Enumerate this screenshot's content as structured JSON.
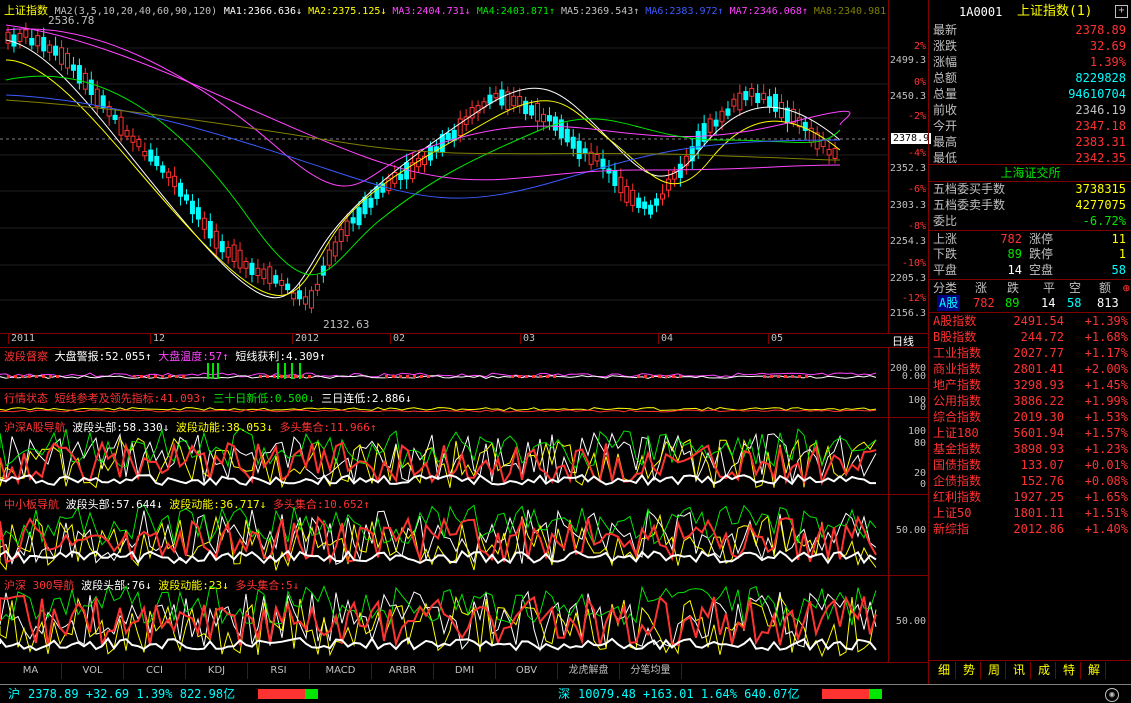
{
  "main": {
    "title": "上证指数",
    "ma_params": "MA2(3,5,10,20,40,60,90,120)",
    "ma_items": [
      {
        "label": "MA1:2366.636↓",
        "color": "#ffffff"
      },
      {
        "label": "MA2:2375.125↓",
        "color": "#ffff00"
      },
      {
        "label": "MA3:2404.731↓",
        "color": "#ff44ff"
      },
      {
        "label": "MA4:2403.871↑",
        "color": "#00e600"
      },
      {
        "label": "MA5:2369.543↑",
        "color": "#c0c0c0"
      },
      {
        "label": "MA6:2383.972↑",
        "color": "#3c5aff"
      },
      {
        "label": "MA7:2346.068↑",
        "color": "#ff44ff"
      },
      {
        "label": "MA8:2340.981",
        "color": "#808000"
      }
    ],
    "high_label": "2536.78",
    "low_label": "2132.63",
    "current_tag": "2378.9",
    "price_axis": [
      "2499.3",
      "2450.3",
      "2352.3",
      "2303.3",
      "2254.3",
      "2205.3",
      "2156.3"
    ],
    "pct_axis": [
      "2%",
      "0%",
      "-2%",
      "-4%",
      "-6%",
      "-8%",
      "-10%",
      "-12%"
    ],
    "date_labels": [
      "2011",
      "12",
      "2012",
      "02",
      "03",
      "04",
      "05"
    ],
    "period_label": "日线"
  },
  "panes": [
    {
      "head": [
        [
          "波段督察",
          "#ff3232"
        ],
        [
          "大盘警报:52.055↑",
          "#ffffff"
        ],
        [
          "大盘温度:57↑",
          "#ff44ff"
        ],
        [
          "短线获利:4.309↑",
          "#ffffff"
        ]
      ],
      "axis": [
        "200.00",
        "0.00"
      ]
    },
    {
      "head": [
        [
          "行情状态",
          "#ff3232"
        ],
        [
          "短线参考及领先指标:41.093↑",
          "#ff3232"
        ],
        [
          "三十日新低:0.500↓",
          "#00e600"
        ],
        [
          "三日连低:2.886↓",
          "#ffffff"
        ]
      ],
      "axis": [
        "100",
        "0"
      ]
    },
    {
      "head": [
        [
          "沪深A股导航",
          "#ff3232"
        ],
        [
          "波段头部:58.330↓",
          "#ffffff"
        ],
        [
          "波段动能:38.053↓",
          "#ffff00"
        ],
        [
          "多头集合:11.966↑",
          "#ff3232"
        ]
      ],
      "axis": [
        "100",
        "80",
        "20",
        "0"
      ]
    },
    {
      "head": [
        [
          "中小板导航",
          "#ff3232"
        ],
        [
          "波段头部:57.644↓",
          "#ffffff"
        ],
        [
          "波段动能:36.717↓",
          "#ffff00"
        ],
        [
          "多头集合:10.652↑",
          "#ff3232"
        ]
      ],
      "axis": [
        "50.00"
      ]
    },
    {
      "head": [
        [
          "沪深 300导航",
          "#ff3232"
        ],
        [
          "波段头部:76↓",
          "#ffffff"
        ],
        [
          "波段动能:23↓",
          "#ffff00"
        ],
        [
          "多头集合:5↓",
          "#ff3232"
        ]
      ],
      "axis": [
        "50.00"
      ]
    }
  ],
  "tabs": [
    "MA",
    "VOL",
    "CCI",
    "KDJ",
    "RSI",
    "MACD",
    "ARBR",
    "DMI",
    "OBV",
    "龙虎解盘",
    "分笔均量"
  ],
  "quote": {
    "code": "1A0001",
    "name": "上证指数(1)",
    "rows": [
      {
        "label": "最新",
        "value": "2378.89",
        "color": "#ff3232"
      },
      {
        "label": "涨跌",
        "value": "32.69",
        "color": "#ff3232"
      },
      {
        "label": "涨幅",
        "value": "1.39%",
        "color": "#ff3232"
      },
      {
        "label": "总额",
        "value": "8229828",
        "color": "#00ffff"
      },
      {
        "label": "总量",
        "value": "94610704",
        "color": "#00ffff"
      },
      {
        "label": "前收",
        "value": "2346.19",
        "color": "#c0c0c0"
      },
      {
        "label": "今开",
        "value": "2347.18",
        "color": "#ff3232"
      },
      {
        "label": "最高",
        "value": "2383.31",
        "color": "#ff3232"
      },
      {
        "label": "最低",
        "value": "2342.35",
        "color": "#ff3232"
      }
    ],
    "exchange": "上海证交所",
    "rows2": [
      {
        "label": "五档委买手数",
        "value": "3738315",
        "color": "#ffff00"
      },
      {
        "label": "五档委卖手数",
        "value": "4277075",
        "color": "#ffff00"
      },
      {
        "label": "委比",
        "value": "-6.72%",
        "color": "#00e600"
      }
    ],
    "updown": [
      {
        "l1": "上涨",
        "v1": "782",
        "c1": "#ff3232",
        "l2": "涨停",
        "v2": "11",
        "c2": "#ffff00"
      },
      {
        "l1": "下跌",
        "v1": "89",
        "c1": "#00e600",
        "l2": "跌停",
        "v2": "1",
        "c2": "#ffff00"
      },
      {
        "l1": "平盘",
        "v1": "14",
        "c1": "#ffffff",
        "l2": "空盘",
        "v2": "58",
        "c2": "#00ffff"
      }
    ],
    "cat_head": [
      "分类",
      "涨",
      "跌",
      "平",
      "空",
      "额"
    ],
    "cat_row": {
      "name": "A股",
      "up": "782",
      "down": "89",
      "flat": "14",
      "empty": "58",
      "amount": "813"
    },
    "indices": [
      {
        "name": "A股指数",
        "value": "2491.54",
        "pct": "+1.39%"
      },
      {
        "name": "B股指数",
        "value": "244.72",
        "pct": "+1.68%"
      },
      {
        "name": "工业指数",
        "value": "2027.77",
        "pct": "+1.17%"
      },
      {
        "name": "商业指数",
        "value": "2801.41",
        "pct": "+2.00%"
      },
      {
        "name": "地产指数",
        "value": "3298.93",
        "pct": "+1.45%"
      },
      {
        "name": "公用指数",
        "value": "3886.22",
        "pct": "+1.99%"
      },
      {
        "name": "综合指数",
        "value": "2019.30",
        "pct": "+1.53%"
      },
      {
        "name": "上证180",
        "value": "5601.94",
        "pct": "+1.57%"
      },
      {
        "name": "基金指数",
        "value": "3898.93",
        "pct": "+1.23%"
      },
      {
        "name": "国债指数",
        "value": "133.07",
        "pct": "+0.01%"
      },
      {
        "name": "企债指数",
        "value": "152.76",
        "pct": "+0.08%"
      },
      {
        "name": "红利指数",
        "value": "1927.25",
        "pct": "+1.65%"
      },
      {
        "name": "上证50",
        "value": "1801.11",
        "pct": "+1.51%"
      },
      {
        "name": "新综指",
        "value": "2012.86",
        "pct": "+1.40%"
      }
    ],
    "bottom_tabs": [
      "细",
      "势",
      "周",
      "讯",
      "成",
      "特",
      "解"
    ]
  },
  "status": {
    "sh_label": "沪",
    "sh_text": "2378.89 +32.69 1.39% 822.98亿",
    "sz_label": "深",
    "sz_text": "10079.48 +163.01 1.64% 640.07亿"
  }
}
